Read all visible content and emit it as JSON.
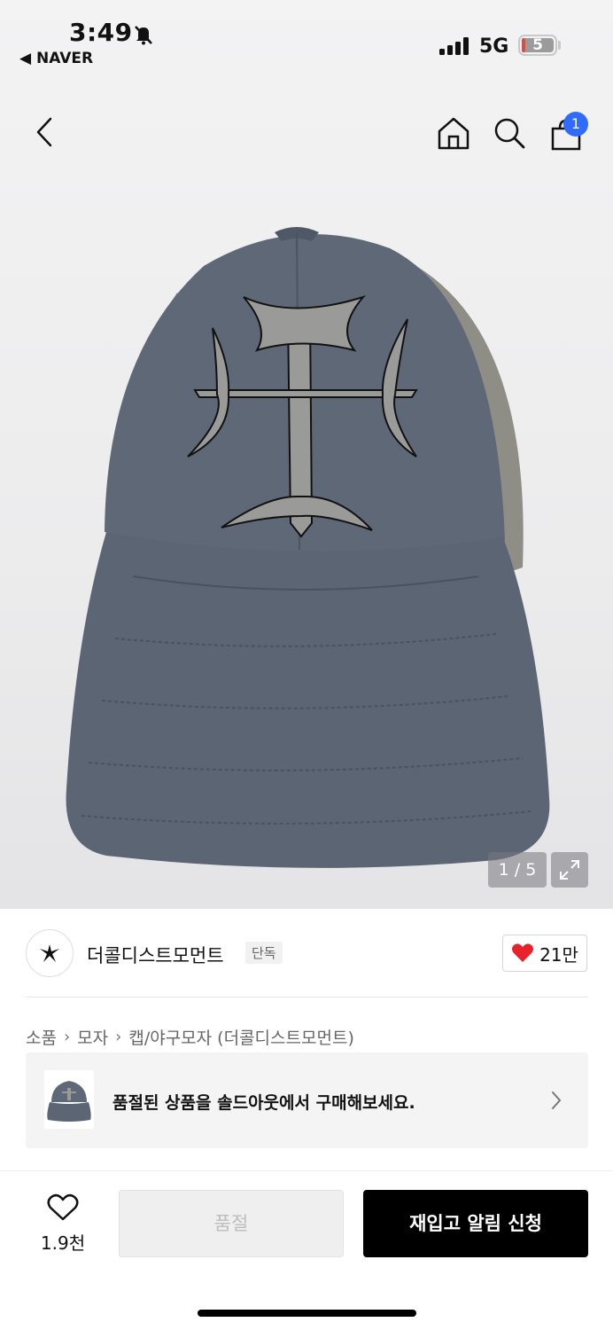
{
  "status_bar": {
    "time": "3:49",
    "back_app": "◀ NAVER",
    "network": "5G",
    "battery": "5",
    "battery_level": 0.05
  },
  "nav": {
    "cart_count": "1"
  },
  "gallery": {
    "counter": "1 / 5"
  },
  "store": {
    "name": "더콜디스트모먼트",
    "tag": "단독",
    "favorites": "21만"
  },
  "breadcrumb": [
    "소품",
    "모자",
    "캡/야구모자 (더콜디스트모먼트)"
  ],
  "banner": {
    "text": "품절된 상품을 솔드아웃에서 구매해보세요."
  },
  "bottom_bar": {
    "wish_count": "1.9천",
    "soldout_label": "품절",
    "restock_label": "재입고 알림 신청"
  },
  "colors": {
    "accent": "#2f6bff",
    "heart": "#e8222a",
    "primary_button": "#000000"
  }
}
